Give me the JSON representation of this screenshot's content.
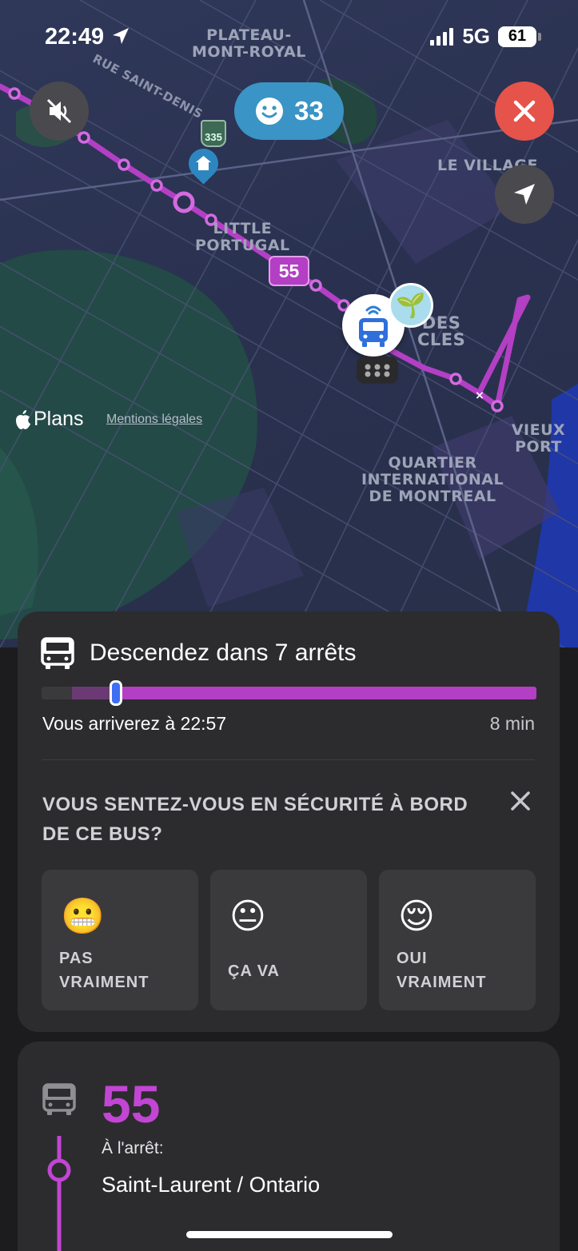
{
  "status_bar": {
    "time": "22:49",
    "network": "5G",
    "battery": "61",
    "icons": [
      "location-arrow-icon",
      "signal-icon"
    ]
  },
  "map": {
    "labels": {
      "plateau": "PLATEAU-\nMONT-ROYAL",
      "saint_denis": "RUE SAINT-DENIS",
      "le_village": "LE VILLAGE",
      "little_portugal": "LITTLE\nPORTUGAL",
      "des_cles": "DES\nCLES",
      "vieux_port": "VIEUX PORT",
      "quartier": "QUARTIER\nINTERNATIONAL\nDE MONTREAL",
      "highway": "335"
    },
    "mood_count": "33",
    "route_badge": "55",
    "attribution": {
      "brand": "Plans",
      "legal": "Mentions légales"
    },
    "colors": {
      "route": "#b33fc4",
      "mood": "#3a94c5",
      "close": "#e5534b"
    }
  },
  "trip": {
    "title": "Descendez dans 7 arrêts",
    "progress": 0.15,
    "arrival": "Vous arriverez à 22:57",
    "duration": "8 min"
  },
  "survey": {
    "question": "VOUS SENTEZ-VOUS EN SÉCURITÉ À BORD DE CE BUS?",
    "options": [
      {
        "emoji": "😬",
        "label": "PAS\nVRAIMENT"
      },
      {
        "emoji": "😐",
        "label": "ÇA VA"
      },
      {
        "emoji": "😌",
        "label": "OUI\nVRAIMENT"
      }
    ]
  },
  "line": {
    "number": "55",
    "stop_label": "À l'arrêt:",
    "stop_name": "Saint-Laurent / Ontario"
  }
}
